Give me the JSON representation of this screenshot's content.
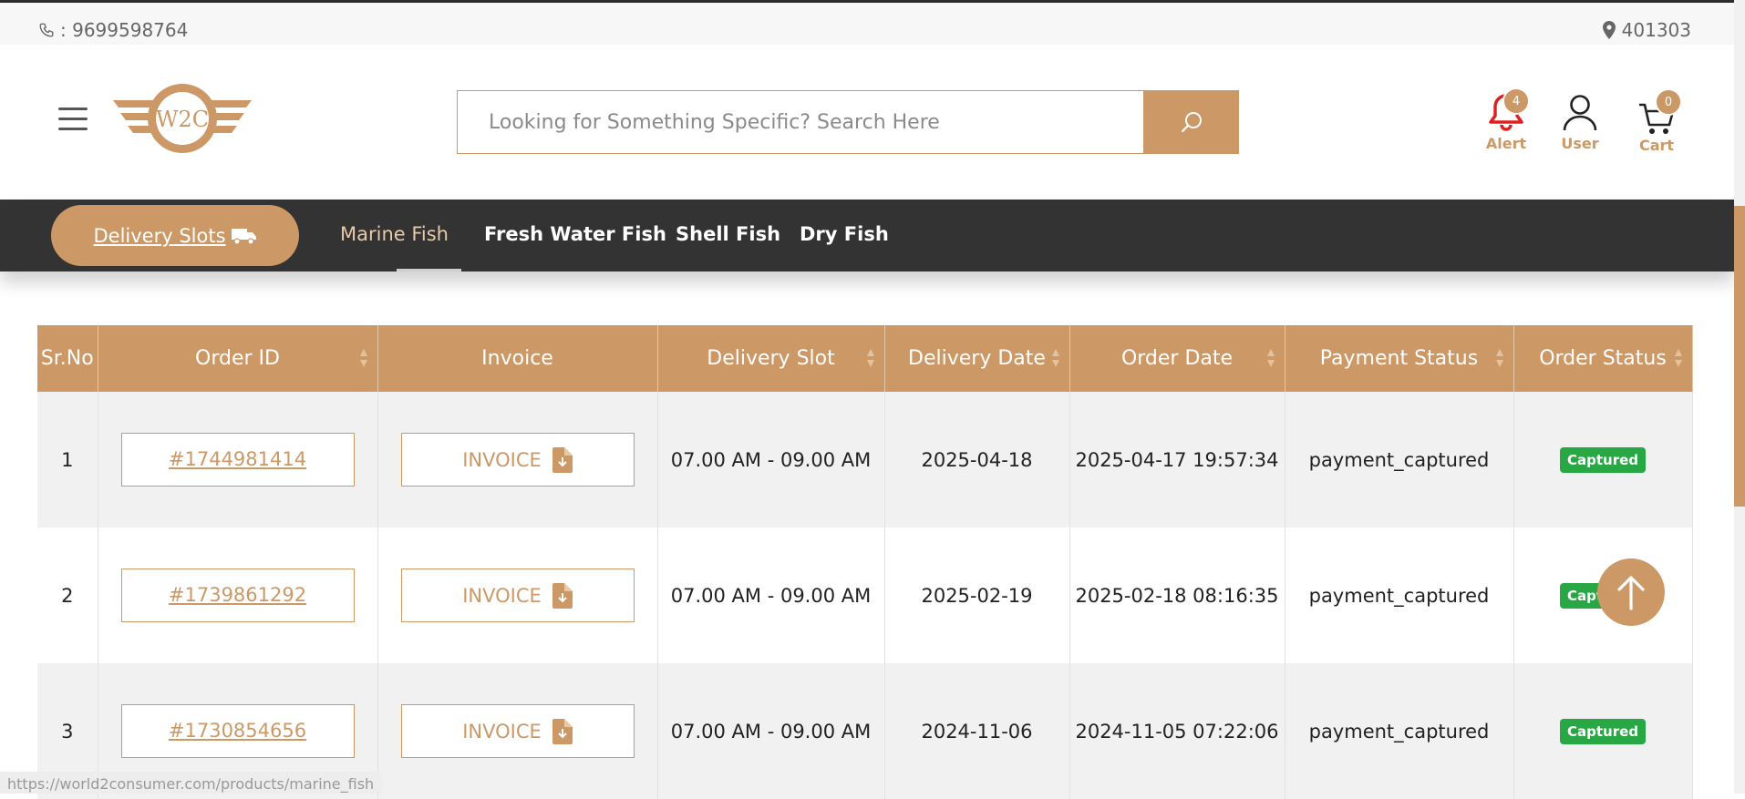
{
  "topbar": {
    "phone": ": 9699598764",
    "pincode": "401303"
  },
  "header": {
    "logo_text": "W2C",
    "search_placeholder": "Looking for Something Specific? Search Here",
    "alert": {
      "label": "Alert",
      "count": "4"
    },
    "user": {
      "label": "User"
    },
    "cart": {
      "label": "Cart",
      "count": "0"
    }
  },
  "nav": {
    "delivery_slots": "Delivery Slots",
    "items": [
      "Marine Fish",
      "Fresh Water Fish",
      "Shell Fish",
      "Dry Fish"
    ]
  },
  "table": {
    "headers": [
      "Sr.No",
      "Order ID",
      "Invoice",
      "Delivery Slot",
      "Delivery Date",
      "Order Date",
      "Payment Status",
      "Order Status"
    ],
    "rows": [
      {
        "sr": "1",
        "order_id": "#1744981414",
        "invoice": "INVOICE",
        "slot": "07.00 AM - 09.00 AM",
        "delivery_date": "2025-04-18",
        "order_date": "2025-04-17 19:57:34",
        "payment": "payment_captured",
        "status": "Captured"
      },
      {
        "sr": "2",
        "order_id": "#1739861292",
        "invoice": "INVOICE",
        "slot": "07.00 AM - 09.00 AM",
        "delivery_date": "2025-02-19",
        "order_date": "2025-02-18 08:16:35",
        "payment": "payment_captured",
        "status": "Captured"
      },
      {
        "sr": "3",
        "order_id": "#1730854656",
        "invoice": "INVOICE",
        "slot": "07.00 AM - 09.00 AM",
        "delivery_date": "2024-11-06",
        "order_date": "2024-11-05 07:22:06",
        "payment": "payment_captured",
        "status": "Captured"
      }
    ]
  },
  "statusbar": {
    "url": "https://world2consumer.com/products/marine_fish"
  },
  "colors": {
    "accent": "#cc9966",
    "nav_bg": "#333333",
    "alert": "#e02020",
    "status_green": "#28a745"
  }
}
